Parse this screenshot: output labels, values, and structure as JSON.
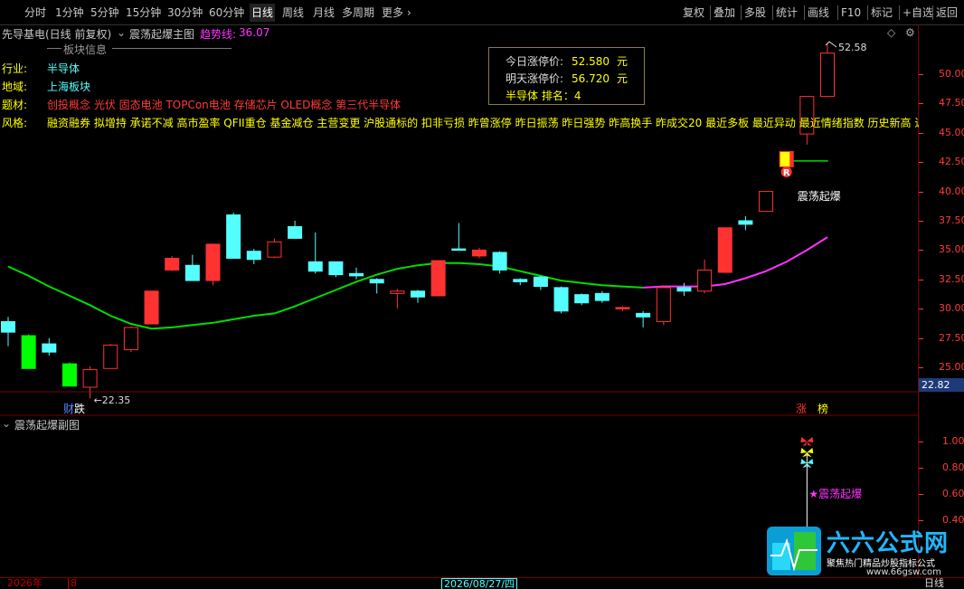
{
  "toolbar": {
    "left": [
      "分时",
      "1分钟",
      "5分钟",
      "15分钟",
      "30分钟",
      "60分钟",
      "日线",
      "周线",
      "月线",
      "多周期",
      "更多"
    ],
    "active": "日线",
    "right": [
      "复权",
      "叠加",
      "多股",
      "统计",
      "画线",
      "F10",
      "标记",
      "+自选",
      "返回"
    ]
  },
  "chart_header": {
    "stock": "先导基电(日线 前复权)",
    "indicator": "震荡起爆主图",
    "trend_label": "趋势线:",
    "trend_value": "36.07"
  },
  "info_panel": {
    "title": "板块信息",
    "industry_label": "行业:",
    "industry": "半导体",
    "region_label": "地域:",
    "region": "上海板块",
    "theme_label": "题材:",
    "theme": "创投概念 光伏 固态电池 TOPCon电池 存储芯片 OLED概念 第三代半导体",
    "style_label": "风格:",
    "style": "融资融券 拟增持 承诺不减 高市盈率 QFII重仓 基金减仓 主营变更 沪股通标的 扣非亏损 昨曾涨停 昨日振荡 昨日强势 昨高换手 昨成交20 最近多板 最近异动 最近情绪指数 历史新高 近期"
  },
  "popup": {
    "today_label": "今日涨停价:",
    "today_value": "52.580",
    "tomorrow_label": "明天涨停价:",
    "tomorrow_value": "56.720",
    "unit": "元",
    "rank_text": "半导体 排名：4"
  },
  "annotations": {
    "high_price": "52.58",
    "low_price": "22.35",
    "signal_text": "震荡起爆",
    "sub_signal_text": "★震荡起爆",
    "r_badge": "R",
    "cai_die": "财跌",
    "zhang": "涨",
    "bang": "榜"
  },
  "axis": {
    "price_ticks": [
      "50.00",
      "47.50",
      "45.00",
      "42.50",
      "40.00",
      "37.50",
      "35.00",
      "32.50",
      "30.00",
      "27.50",
      "25.00"
    ],
    "current_price": "22.82",
    "sub_ticks": [
      "1.00",
      "0.80",
      "0.60",
      "0.40"
    ]
  },
  "sub_chart": {
    "title": "震荡起爆副图"
  },
  "bottom": {
    "year": "2026年",
    "month": "8",
    "date_box": "2026/08/27/四",
    "period": "日线"
  },
  "watermark": {
    "big": "六六公式网",
    "small": "聚焦热门精品炒股指标公式",
    "url": "www.66gsw.com"
  },
  "colors": {
    "up": "#ff3232",
    "down_hollow": "#54ffff",
    "strong_down": "#00ff00",
    "trend_green": "#00dd00",
    "trend_magenta": "#ff33ff",
    "label_yellow": "#ffff00",
    "theme_red": "#ff3a3a"
  },
  "chart_data": {
    "type": "candlestick",
    "y_axis_ticks": [
      25,
      27.5,
      30,
      32.5,
      35,
      37.5,
      40,
      42.5,
      45,
      47.5,
      50
    ],
    "candles": [
      {
        "o": 28.9,
        "h": 29.3,
        "c": 28.0,
        "l": 26.8,
        "t": "down"
      },
      {
        "o": 27.7,
        "h": 27.8,
        "c": 24.9,
        "l": 24.9,
        "t": "strong"
      },
      {
        "o": 27.0,
        "h": 27.5,
        "c": 26.3,
        "l": 26.0,
        "t": "down"
      },
      {
        "o": 25.3,
        "h": 25.4,
        "c": 23.4,
        "l": 23.4,
        "t": "strong"
      },
      {
        "o": 23.3,
        "h": 25.1,
        "c": 24.8,
        "l": 22.35,
        "t": "up_hollow"
      },
      {
        "o": 24.9,
        "h": 27.0,
        "c": 26.9,
        "l": 24.9,
        "t": "up_hollow"
      },
      {
        "o": 26.5,
        "h": 28.5,
        "c": 28.4,
        "l": 26.3,
        "t": "up_hollow"
      },
      {
        "o": 28.7,
        "h": 31.5,
        "c": 31.5,
        "l": 28.7,
        "t": "up"
      },
      {
        "o": 33.3,
        "h": 34.5,
        "c": 34.3,
        "l": 33.2,
        "t": "up"
      },
      {
        "o": 33.7,
        "h": 34.6,
        "c": 32.4,
        "l": 32.4,
        "t": "down"
      },
      {
        "o": 32.4,
        "h": 35.5,
        "c": 35.5,
        "l": 32.0,
        "t": "up"
      },
      {
        "o": 38.0,
        "h": 38.2,
        "c": 34.3,
        "l": 34.3,
        "t": "down"
      },
      {
        "o": 34.9,
        "h": 35.1,
        "c": 34.2,
        "l": 33.8,
        "t": "down"
      },
      {
        "o": 34.4,
        "h": 36.0,
        "c": 35.7,
        "l": 34.3,
        "t": "up_hollow"
      },
      {
        "o": 37.0,
        "h": 37.5,
        "c": 36.0,
        "l": 36.0,
        "t": "down"
      },
      {
        "o": 34.0,
        "h": 36.5,
        "c": 33.2,
        "l": 33.0,
        "t": "down"
      },
      {
        "o": 34.0,
        "h": 34.0,
        "c": 32.9,
        "l": 32.7,
        "t": "down"
      },
      {
        "o": 33.0,
        "h": 33.5,
        "c": 32.8,
        "l": 32.5,
        "t": "down"
      },
      {
        "o": 32.5,
        "h": 32.6,
        "c": 32.2,
        "l": 31.3,
        "t": "down"
      },
      {
        "o": 31.3,
        "h": 31.7,
        "c": 31.5,
        "l": 30.0,
        "t": "up_hollow"
      },
      {
        "o": 31.5,
        "h": 31.6,
        "c": 31.0,
        "l": 30.5,
        "t": "down"
      },
      {
        "o": 31.1,
        "h": 34.1,
        "c": 34.1,
        "l": 31.1,
        "t": "up"
      },
      {
        "o": 35.0,
        "h": 37.3,
        "c": 35.1,
        "l": 35.0,
        "t": "down_flat"
      },
      {
        "o": 35.0,
        "h": 35.2,
        "c": 34.5,
        "l": 34.3,
        "t": "up"
      },
      {
        "o": 34.8,
        "h": 34.9,
        "c": 33.3,
        "l": 33.0,
        "t": "down"
      },
      {
        "o": 32.5,
        "h": 32.6,
        "c": 32.3,
        "l": 32.0,
        "t": "down"
      },
      {
        "o": 32.7,
        "h": 32.8,
        "c": 31.9,
        "l": 31.6,
        "t": "down"
      },
      {
        "o": 31.8,
        "h": 31.9,
        "c": 29.8,
        "l": 29.6,
        "t": "down"
      },
      {
        "o": 31.2,
        "h": 31.3,
        "c": 30.5,
        "l": 30.3,
        "t": "down"
      },
      {
        "o": 31.3,
        "h": 31.5,
        "c": 30.7,
        "l": 30.5,
        "t": "down"
      },
      {
        "o": 30.1,
        "h": 30.2,
        "c": 30.0,
        "l": 29.8,
        "t": "up"
      },
      {
        "o": 29.6,
        "h": 29.8,
        "c": 29.3,
        "l": 28.4,
        "t": "down"
      },
      {
        "o": 28.9,
        "h": 32.0,
        "c": 31.8,
        "l": 28.6,
        "t": "up_hollow"
      },
      {
        "o": 31.8,
        "h": 32.2,
        "c": 31.5,
        "l": 31.1,
        "t": "down"
      },
      {
        "o": 31.5,
        "h": 34.2,
        "c": 33.3,
        "l": 31.3,
        "t": "up_hollow"
      },
      {
        "o": 33.1,
        "h": 36.9,
        "c": 36.9,
        "l": 33.1,
        "t": "up"
      },
      {
        "o": 37.5,
        "h": 37.9,
        "c": 37.2,
        "l": 36.7,
        "t": "down"
      },
      {
        "o": 38.3,
        "h": 40.0,
        "c": 40.0,
        "l": 38.3,
        "t": "up_hollow"
      },
      {
        "o": 42.1,
        "h": 43.4,
        "c": 43.4,
        "l": 42.1,
        "t": "special"
      },
      {
        "o": 44.9,
        "h": 48.1,
        "c": 48.1,
        "l": 44.0,
        "t": "up_hollow"
      },
      {
        "o": 48.1,
        "h": 52.58,
        "c": 51.8,
        "l": 48.1,
        "t": "up_hollow"
      }
    ],
    "trend_line": [
      33.6,
      32.8,
      31.9,
      31.1,
      30.3,
      29.4,
      28.7,
      28.3,
      28.4,
      28.6,
      28.8,
      29.1,
      29.4,
      29.6,
      30.2,
      30.9,
      31.6,
      32.3,
      32.9,
      33.4,
      33.7,
      33.9,
      33.9,
      33.8,
      33.6,
      33.2,
      32.8,
      32.4,
      32.2,
      32.0,
      31.9,
      31.8,
      31.9,
      31.9,
      31.9,
      32.1,
      32.6,
      33.2,
      34.0,
      35.0,
      36.1
    ],
    "trend_split_index": 31,
    "sub_signal": {
      "index": 39,
      "value": 1.0
    }
  }
}
